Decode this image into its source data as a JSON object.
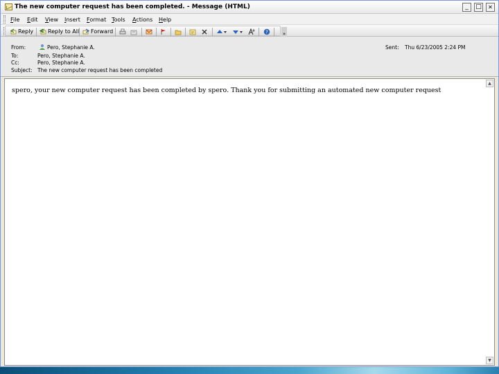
{
  "window": {
    "title": "The new computer request has been completed. - Message (HTML)",
    "minimize": "_",
    "maximize": "□",
    "close": "✕"
  },
  "menu": [
    "File",
    "Edit",
    "View",
    "Insert",
    "Format",
    "Tools",
    "Actions",
    "Help"
  ],
  "toolbar": {
    "reply": "Reply",
    "reply_all": "Reply to All",
    "forward": "Forward",
    "overflow": "»"
  },
  "header": {
    "from_label": "From:",
    "from_value": "Pero, Stephanie A.",
    "to_label": "To:",
    "to_value": "Pero, Stephanie A.",
    "cc_label": "Cc:",
    "cc_value": "Pero, Stephanie A.",
    "subject_label": "Subject:",
    "subject_value": "The new computer request has been completed",
    "sent_label": "Sent:",
    "sent_value": "Thu 6/23/2005 2:24 PM"
  },
  "body": {
    "text": "spero, your new computer request has been completed by spero. Thank you for submitting an automated new computer request"
  },
  "colors": {
    "window_border": "#7a96df",
    "taskbar": "#2580b0"
  }
}
